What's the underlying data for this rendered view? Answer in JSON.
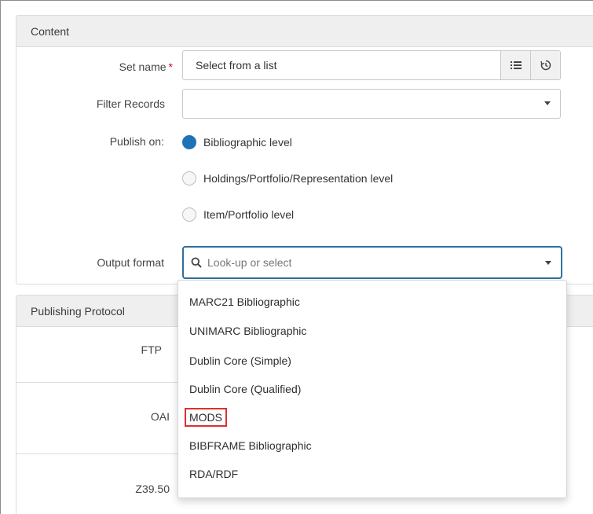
{
  "content_panel": {
    "header": "Content",
    "set_name": {
      "label": "Set name",
      "required_mark": "*",
      "value": "Select from a list"
    },
    "filter_records": {
      "label": "Filter Records",
      "value": ""
    },
    "publish_on": {
      "label": "Publish on:",
      "options": [
        {
          "label": "Bibliographic level",
          "selected": true
        },
        {
          "label": "Holdings/Portfolio/Representation level",
          "selected": false
        },
        {
          "label": "Item/Portfolio level",
          "selected": false
        }
      ]
    },
    "output_format": {
      "label": "Output format",
      "placeholder": "Look-up or select"
    }
  },
  "protocol_panel": {
    "header": "Publishing Protocol",
    "rows": [
      "FTP",
      "OAI",
      "Z39.50"
    ]
  },
  "dropdown": {
    "options": [
      "MARC21 Bibliographic",
      "UNIMARC Bibliographic",
      "Dublin Core (Simple)",
      "Dublin Core (Qualified)",
      "MODS",
      "BIBFRAME Bibliographic",
      "RDA/RDF"
    ],
    "highlighted": "MODS"
  },
  "colors": {
    "accent": "#1e73b7",
    "focus_border": "#2f6f9f",
    "highlight_box": "#d9322f",
    "required": "#d0021b"
  },
  "icons": {
    "list": "list-icon",
    "history": "history-icon",
    "search": "search-icon",
    "caret": "caret-down-icon"
  }
}
